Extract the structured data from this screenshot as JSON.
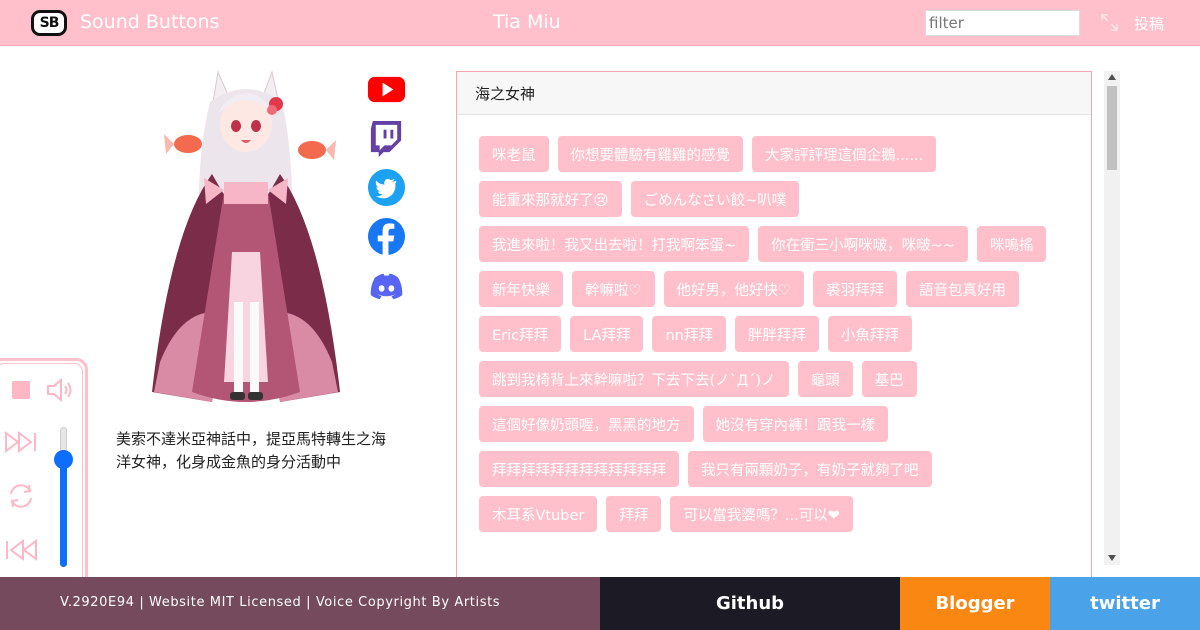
{
  "header": {
    "logo_text": "SB",
    "site_title": "Sound Buttons",
    "page_title": "Tia Miu",
    "filter_placeholder": "filter",
    "post_label": "投稿",
    "bg_color": "#ffc0cb"
  },
  "profile": {
    "description": "美索不達米亞神話中，提亞馬特轉生之海洋女神，化身成金魚的身分活動中",
    "social_icons": [
      "youtube-icon",
      "twitch-icon",
      "twitter-icon",
      "facebook-icon",
      "discord-icon"
    ]
  },
  "player": {
    "controls": [
      "stop-icon",
      "volume-icon",
      "next-icon",
      "repeat-icon",
      "previous-icon"
    ],
    "volume": 0.77
  },
  "sound_group": {
    "title": "海之女神",
    "buttons": [
      "咪老鼠",
      "你想要體驗有雞雞的感覺",
      "大家評評理這個企鵝......",
      "能重來那就好了😢",
      "ごめんなさい餃~叭噗",
      "我進來啦！我又出去啦！打我啊笨蛋~",
      "你在衝三小啊咪啵，咪啵~~",
      "咪嗚搖",
      "新年快樂",
      "幹嘛啦♡",
      "他好男，他好快♡",
      "裘羽拜拜",
      "語音包真好用",
      "Eric拜拜",
      "LA拜拜",
      "nn拜拜",
      "胖胖拜拜",
      "小魚拜拜",
      "跳到我椅背上來幹嘛啦？下去下去(ノ`Д´)ノ",
      "龜頭",
      "基巴",
      "這個好像奶頭喔，黑黑的地方",
      "她沒有穿內褲！跟我一樣",
      "拜拜拜拜拜拜拜拜拜拜拜拜",
      "我只有兩顆奶子，有奶子就夠了吧",
      "木耳系Vtuber",
      "拜拜",
      "可以當我婆嗎？...可以❤"
    ],
    "button_color": "#ffc0cb"
  },
  "footer": {
    "info": "V.2920E94 | Website MIT Licensed | Voice Copyright By Artists",
    "github": "Github",
    "blogger": "Blogger",
    "twitter": "twitter",
    "colors": {
      "info": "#744a5c",
      "github": "#1c1a24",
      "blogger": "#fb8713",
      "twitter": "#4aa3e8"
    }
  }
}
